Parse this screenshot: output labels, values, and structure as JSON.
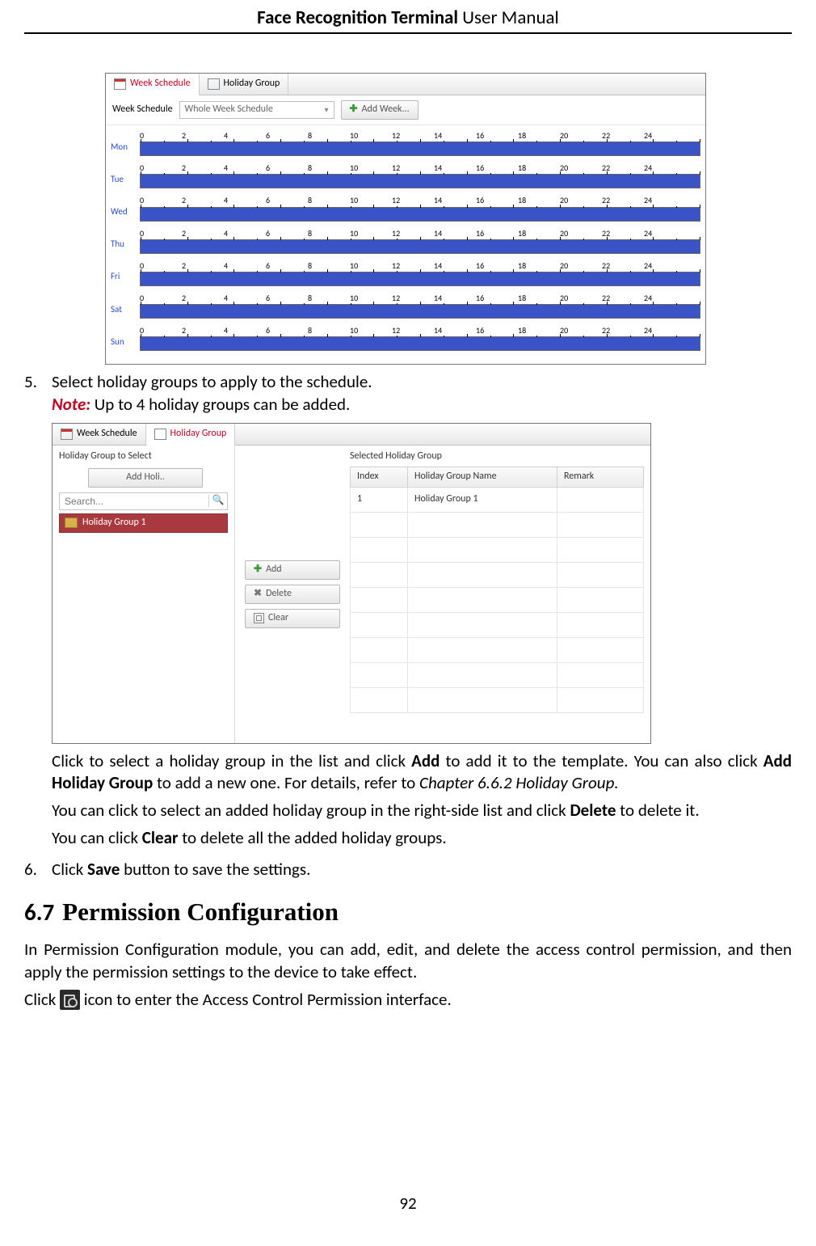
{
  "header": {
    "title_bold": "Face Recognition Terminal",
    "title_light": "  User Manual"
  },
  "page_number": "92",
  "fig1": {
    "tab_week": "Week Schedule",
    "tab_holiday": "Holiday Group",
    "row_label": "Week Schedule",
    "select_value": "Whole Week Schedule",
    "add_week_btn": "Add Week...",
    "days": [
      "Mon",
      "Tue",
      "Wed",
      "Thu",
      "Fri",
      "Sat",
      "Sun"
    ],
    "ticks": [
      "0",
      "2",
      "4",
      "6",
      "8",
      "10",
      "12",
      "14",
      "16",
      "18",
      "20",
      "22",
      "24"
    ]
  },
  "step5": {
    "num": "5.",
    "text": "Select holiday groups to apply to the schedule.",
    "note_label": "Note:",
    "note_text": " Up to 4 holiday groups can be added."
  },
  "fig2": {
    "tab_week": "Week Schedule",
    "tab_holiday": "Holiday Group",
    "left_title": "Holiday Group to Select",
    "add_holi_btn": "Add Holi..",
    "search_placeholder": "Search...",
    "selected_item": "Holiday Group 1",
    "mid": {
      "add": "Add",
      "delete": "Delete",
      "clear": "Clear"
    },
    "right_title": "Selected Holiday Group",
    "cols": {
      "c1": "Index",
      "c2": "Holiday Group Name",
      "c3": "Remark"
    },
    "row": {
      "c1": "1",
      "c2": "Holiday Group 1",
      "c3": ""
    }
  },
  "after_fig2": {
    "p1a": "Click to select a holiday group in the list and click ",
    "p1b": "Add",
    "p1c": " to add it to the template. You can also click ",
    "p1d": "Add Holiday Group",
    "p1e": " to add a new one. For details, refer to ",
    "p1f": "Chapter 6.6.2 Holiday Group.",
    "p2a": "You can click to select an added holiday group in the right-side list and click ",
    "p2b": "Delete",
    "p2c": " to delete it.",
    "p3a": "You can click ",
    "p3b": "Clear",
    "p3c": " to delete all the added holiday groups."
  },
  "step6": {
    "num": "6.",
    "a": "Click ",
    "b": "Save",
    "c": " button to save the settings."
  },
  "h2": {
    "num": "6.7",
    "text": "Permission Configuration"
  },
  "perm_p1": "In Permission Configuration module, you can add, edit, and delete the access control permission, and then apply the permission settings to the device to take effect.",
  "perm_p2a": "Click ",
  "perm_p2b": " icon to enter the Access Control Permission interface."
}
